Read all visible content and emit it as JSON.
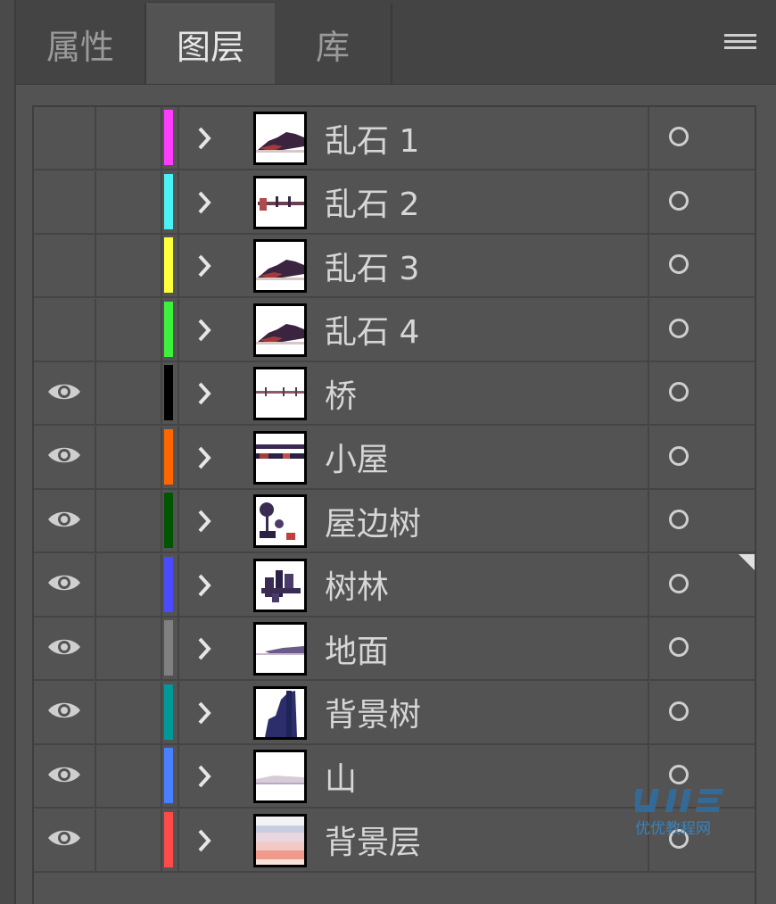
{
  "tabs": [
    {
      "label": "属性",
      "active": false
    },
    {
      "label": "图层",
      "active": true
    },
    {
      "label": "库",
      "active": false
    }
  ],
  "menu_icon": "hamburger-menu-icon",
  "layers": [
    {
      "name": "乱石 1",
      "color": "#ff3cff",
      "visible": false,
      "thumb": "rock"
    },
    {
      "name": "乱石 2",
      "color": "#4af1f5",
      "visible": false,
      "thumb": "rock2"
    },
    {
      "name": "乱石 3",
      "color": "#ffff3c",
      "visible": false,
      "thumb": "rock"
    },
    {
      "name": "乱石 4",
      "color": "#3cf23c",
      "visible": false,
      "thumb": "rock"
    },
    {
      "name": "桥",
      "color": "#000000",
      "visible": true,
      "thumb": "bridge"
    },
    {
      "name": "小屋",
      "color": "#ff6600",
      "visible": true,
      "thumb": "hut"
    },
    {
      "name": "屋边树",
      "color": "#005500",
      "visible": true,
      "thumb": "trees-small"
    },
    {
      "name": "树林",
      "color": "#4a4aff",
      "visible": true,
      "thumb": "forest"
    },
    {
      "name": "地面",
      "color": "#808080",
      "visible": true,
      "thumb": "ground"
    },
    {
      "name": "背景树",
      "color": "#009999",
      "visible": true,
      "thumb": "bg-trees"
    },
    {
      "name": "山",
      "color": "#4a80ff",
      "visible": true,
      "thumb": "mountain"
    },
    {
      "name": "背景层",
      "color": "#ff4a4a",
      "visible": true,
      "thumb": "background"
    }
  ],
  "watermark": {
    "brand": "UiiE",
    "text": "优优教程网"
  }
}
